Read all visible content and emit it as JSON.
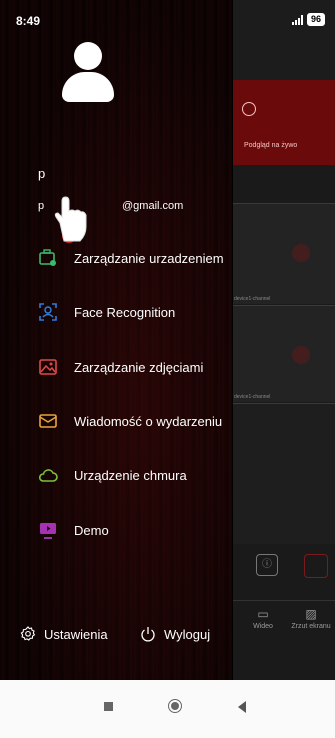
{
  "status_bar": {
    "time": "8:49",
    "battery": "96"
  },
  "background_app": {
    "live_label": "Podgląd na żywo",
    "bottom_nav": [
      {
        "label": "Wideo",
        "icon": "video-icon"
      },
      {
        "label": "Zrzut ekranu",
        "icon": "image-icon"
      }
    ],
    "cell_captions": [
      "device1-channel",
      "device1-channel"
    ]
  },
  "drawer": {
    "user": {
      "name": "p",
      "email_prefix": "p",
      "email_domain": "@gmail.com"
    },
    "menu": [
      {
        "label": "Zarządzanie urzadzeniem",
        "icon": "device-management-icon",
        "color": "#3dbb6b"
      },
      {
        "label": "Face Recognition",
        "icon": "face-recognition-icon",
        "color": "#2e7de0"
      },
      {
        "label": "Zarządzanie zdjęciami",
        "icon": "photo-management-icon",
        "color": "#e04848"
      },
      {
        "label": "Wiadomość o wydarzeniu",
        "icon": "event-message-icon",
        "color": "#e8a53a"
      },
      {
        "label": "Urządzenie chmura",
        "icon": "cloud-device-icon",
        "color": "#7ec23c"
      },
      {
        "label": "Demo",
        "icon": "demo-icon",
        "color": "#c03bd0"
      }
    ],
    "footer": {
      "settings_label": "Ustawienia",
      "logout_label": "Wyloguj"
    }
  }
}
